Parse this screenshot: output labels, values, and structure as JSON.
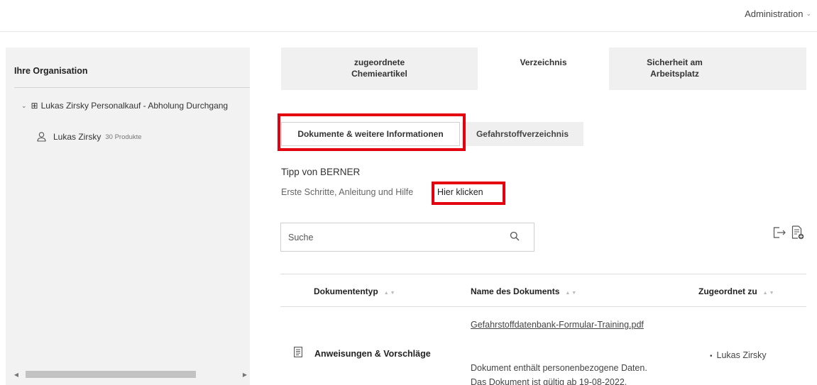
{
  "header": {
    "admin_label": "Administration"
  },
  "sidebar": {
    "title": "Ihre Organisation",
    "org_name": "Lukas Zirsky Personalkauf - Abholung Durchgang",
    "user_name": "Lukas Zirsky",
    "user_count": "30 Produkte"
  },
  "main_tabs": [
    {
      "label_line1": "zugeordnete",
      "label_line2": "Chemieartikel"
    },
    {
      "label_line1": "Verzeichnis",
      "label_line2": ""
    },
    {
      "label_line1": "Sicherheit am",
      "label_line2": "Arbeitsplatz"
    }
  ],
  "sub_tabs": {
    "active": "Dokumente & weitere Informationen",
    "inactive": "Gefahrstoffverzeichnis"
  },
  "tip": {
    "title": "Tipp von BERNER",
    "text": "Erste Schritte, Anleitung und Hilfe",
    "link": "Hier klicken"
  },
  "search": {
    "placeholder": "Suche"
  },
  "table": {
    "columns": [
      "Dokumententyp",
      "Name des Dokuments",
      "Zugeordnet zu"
    ],
    "rows": [
      {
        "type": "Anweisungen & Vorschläge",
        "name": "Gefahrstoffdatenbank-Formular-Training.pdf",
        "note1": "Dokument enthält personenbezogene Daten.",
        "note2": "Das Dokument ist gültig ab 19-08-2022.",
        "assigned": "Lukas Zirsky"
      }
    ]
  },
  "colors": {
    "highlight": "#e3000f",
    "tab_bg": "#f0f0f0",
    "sidebar_bg": "#f2f2f2"
  }
}
